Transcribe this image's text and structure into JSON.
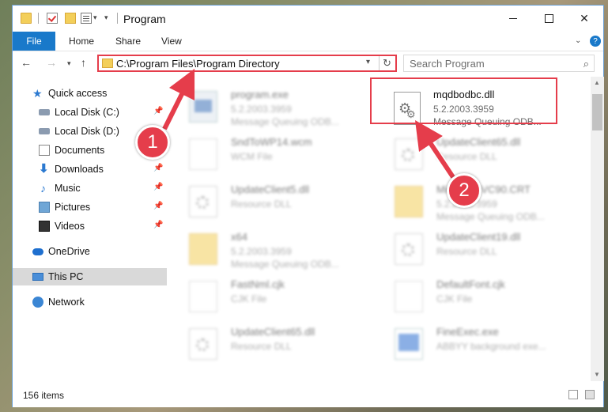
{
  "window": {
    "title": "Program",
    "controls": {
      "minimize_icon": "minimize-icon",
      "maximize_icon": "maximize-icon",
      "close_glyph": "✕"
    }
  },
  "ribbon": {
    "tabs": [
      "File",
      "Home",
      "Share",
      "View"
    ],
    "help": "?"
  },
  "nav": {
    "address": "C:\\Program Files\\Program Directory",
    "search_placeholder": "Search Program"
  },
  "sidebar": {
    "items": [
      {
        "label": "Quick access",
        "icon": "star-icon",
        "pinned": false
      },
      {
        "label": "Local Disk (C:)",
        "icon": "disk-icon",
        "pinned": true
      },
      {
        "label": "Local Disk (D:)",
        "icon": "disk-icon",
        "pinned": false
      },
      {
        "label": "Documents",
        "icon": "documents-icon",
        "pinned": false
      },
      {
        "label": "Downloads",
        "icon": "downloads-icon",
        "pinned": true
      },
      {
        "label": "Music",
        "icon": "music-icon",
        "pinned": true
      },
      {
        "label": "Pictures",
        "icon": "pictures-icon",
        "pinned": true
      },
      {
        "label": "Videos",
        "icon": "videos-icon",
        "pinned": true
      },
      {
        "label": "OneDrive",
        "icon": "onedrive-icon",
        "pinned": false
      },
      {
        "label": "This PC",
        "icon": "this-pc-icon",
        "pinned": false,
        "selected": true
      },
      {
        "label": "Network",
        "icon": "network-icon",
        "pinned": false
      }
    ]
  },
  "files": {
    "left": [
      {
        "name": "program.exe",
        "version": "5.2.2003.3959",
        "desc": "Message Queuing ODB..."
      },
      {
        "name": "SndToWP14.wcm",
        "version": "WCM File",
        "desc": ""
      },
      {
        "name": "UpdateClient5.dll",
        "version": "Resource DLL",
        "desc": ""
      },
      {
        "name": "x64",
        "version": "5.2.2003.3959",
        "desc": "Message Queuing ODB..."
      },
      {
        "name": "FastNml.cjk",
        "version": "CJK File",
        "desc": ""
      },
      {
        "name": "UpdateClient65.dll",
        "version": "Resource DLL",
        "desc": ""
      }
    ],
    "right": [
      {
        "name": "mqdbodbc.dll",
        "version": "5.2.2003.3959",
        "desc": "Message Queuing ODB..."
      },
      {
        "name": "UpdateClient65.dll",
        "version": "Resource DLL",
        "desc": ""
      },
      {
        "name": "Microsoft.VC90.CRT",
        "version": "5.2.2003.3959",
        "desc": "Message Queuing ODB..."
      },
      {
        "name": "UpdateClient19.dll",
        "version": "Resource DLL",
        "desc": ""
      },
      {
        "name": "DefaultFont.cjk",
        "version": "CJK File",
        "desc": ""
      },
      {
        "name": "FineExec.exe",
        "version": "ABBYY background exe...",
        "desc": ""
      }
    ]
  },
  "status": {
    "count": "156 items"
  },
  "annotations": {
    "callout_1": "1",
    "callout_2": "2",
    "color": "#e53d4b"
  }
}
